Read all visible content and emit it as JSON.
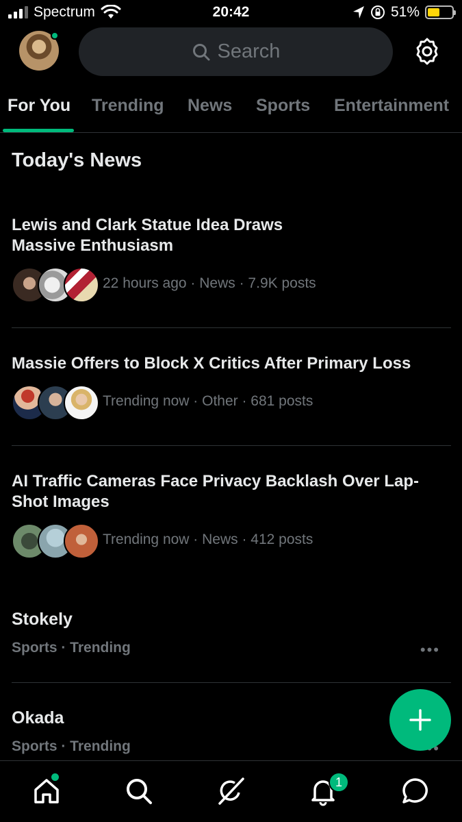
{
  "status_bar": {
    "carrier": "Spectrum",
    "time": "20:42",
    "battery": "51%",
    "battery_level": 0.51
  },
  "header": {
    "search_placeholder": "Search"
  },
  "tabs": [
    "For You",
    "Trending",
    "News",
    "Sports",
    "Entertainment"
  ],
  "section_title": "Today's News",
  "stories": [
    {
      "headline": "Lewis and Clark Statue Idea Draws Massive Enthusiasm",
      "meta": "22 hours ago · News · 7.9K posts"
    },
    {
      "headline": "Massie Offers to Block X Critics After Primary Loss",
      "meta": "Trending now · Other · 681 posts"
    },
    {
      "headline": "AI Traffic Cameras Face Privacy Backlash Over Lap-Shot Images",
      "meta": "Trending now · News · 412 posts"
    }
  ],
  "topics": [
    {
      "name": "Stokely",
      "sub": "Sports · Trending"
    },
    {
      "name": "Okada",
      "sub": "Sports · Trending"
    }
  ],
  "more_label": "•••",
  "fab_icon": "plus-icon",
  "notifications_badge": "1",
  "colors": {
    "accent": "#00ba7c",
    "background": "#000000",
    "muted": "#71767b"
  }
}
